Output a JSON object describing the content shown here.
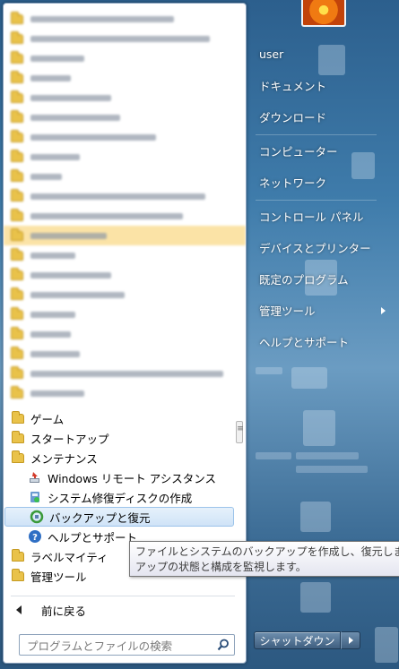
{
  "programs": {
    "folders": [
      {
        "label": "ゲーム"
      },
      {
        "label": "スタートアップ"
      },
      {
        "label": "メンテナンス"
      }
    ],
    "maintenance_items": [
      {
        "label": "Windows リモート アシスタンス",
        "icon": "remote-assistance-icon"
      },
      {
        "label": "システム修復ディスクの作成",
        "icon": "repair-disc-icon"
      },
      {
        "label": "バックアップと復元",
        "icon": "backup-restore-icon"
      },
      {
        "label": "ヘルプとサポート",
        "icon": "help-icon"
      }
    ],
    "after_folders": [
      {
        "label": "ラベルマイティ"
      },
      {
        "label": "管理ツール"
      }
    ],
    "back_label": "前に戻る",
    "search_placeholder": "プログラムとファイルの検索"
  },
  "right_panel": {
    "user": "user",
    "documents": "ドキュメント",
    "downloads": "ダウンロード",
    "computer": "コンピューター",
    "network": "ネットワーク",
    "control_panel": "コントロール パネル",
    "devices_printers": "デバイスとプリンター",
    "default_programs": "既定のプログラム",
    "admin_tools": "管理ツール",
    "help_support": "ヘルプとサポート"
  },
  "shutdown_label": "シャットダウン",
  "tooltip": {
    "line1": "ファイルとシステムのバックアップを作成し、復元しま",
    "line2": "アップの状態と構成を監視します。"
  }
}
